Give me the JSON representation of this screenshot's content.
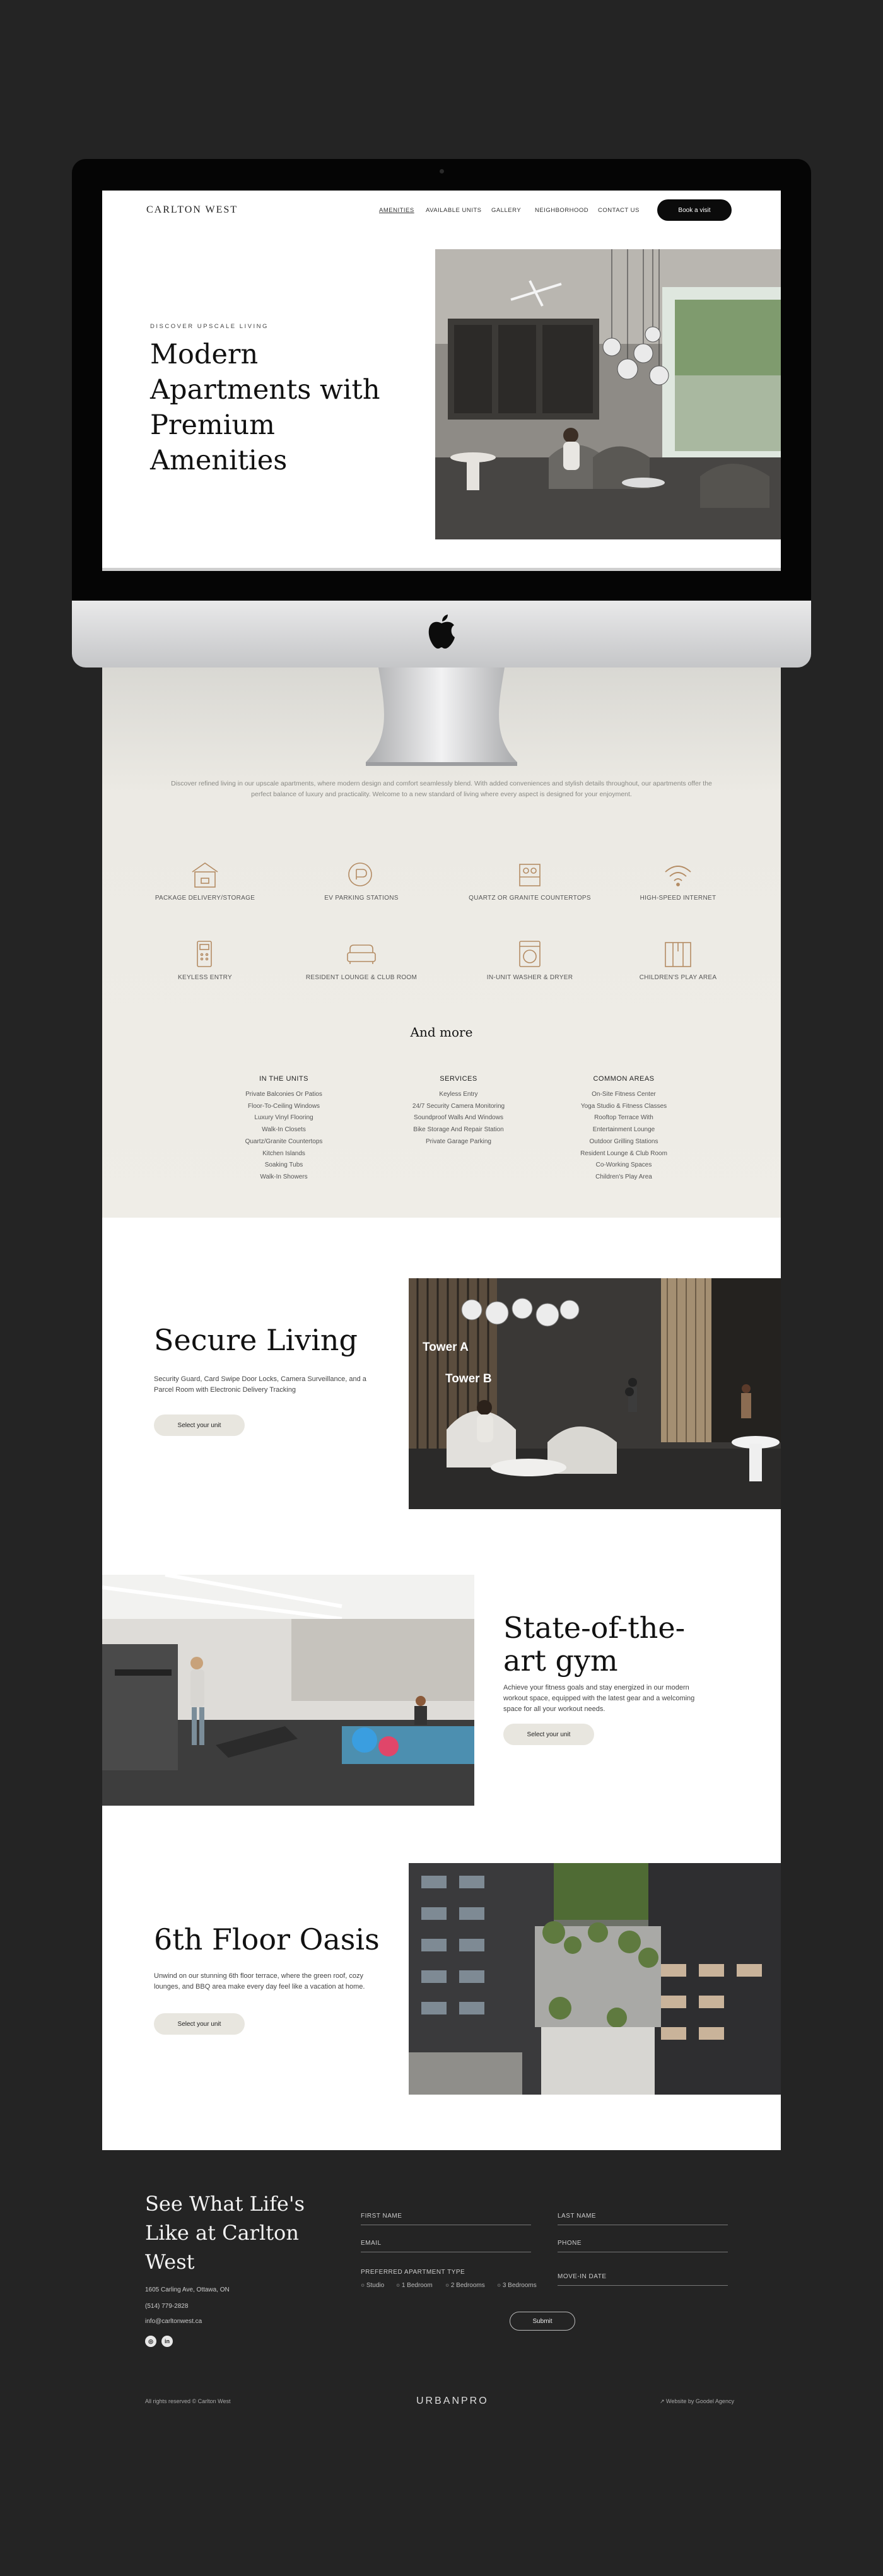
{
  "nav": {
    "logo": "CARLTON WEST",
    "links": [
      "AMENITIES",
      "AVAILABLE UNITS",
      "GALLERY",
      "NEIGHBORHOOD",
      "CONTACT US"
    ],
    "cta": "Book a visit"
  },
  "hero": {
    "eyebrow": "DISCOVER UPSCALE LIVING",
    "title": "Modern Apartments with Premium Amenities"
  },
  "amenities": {
    "intro": "Discover refined living in our upscale apartments, where modern design and comfort seamlessly blend. With added conveniences and stylish details throughout, our apartments offer the perfect balance of luxury and practicality. Welcome to a new standard of living where every aspect is designed for your enjoyment.",
    "items": [
      {
        "label": "PACKAGE DELIVERY/STORAGE",
        "icon": "package-icon"
      },
      {
        "label": "EV PARKING STATIONS",
        "icon": "ev-charging-icon"
      },
      {
        "label": "QUARTZ OR GRANITE COUNTERTOPS",
        "icon": "countertop-icon"
      },
      {
        "label": "HIGH-SPEED INTERNET",
        "icon": "wifi-icon"
      },
      {
        "label": "KEYLESS ENTRY",
        "icon": "keypad-icon"
      },
      {
        "label": "RESIDENT LOUNGE & CLUB ROOM",
        "icon": "sofa-icon"
      },
      {
        "label": "IN-UNIT WASHER & DRYER",
        "icon": "washer-icon"
      },
      {
        "label": "CHILDREN'S PLAY AREA",
        "icon": "play-area-icon"
      }
    ],
    "and_more": "And more",
    "columns": [
      {
        "title": "IN THE UNITS",
        "items": [
          "Private Balconies Or Patios",
          "Floor-To-Ceiling Windows",
          "Luxury Vinyl Flooring",
          "Walk-In Closets",
          "Quartz/Granite Countertops",
          "Kitchen Islands",
          "Soaking Tubs",
          "Walk-In Showers"
        ]
      },
      {
        "title": "SERVICES",
        "items": [
          "Keyless Entry",
          "24/7 Security Camera Monitoring",
          "Soundproof Walls And Windows",
          "Bike Storage And Repair Station",
          "Private Garage Parking"
        ]
      },
      {
        "title": "COMMON AREAS",
        "items": [
          "On-Site Fitness Center",
          "Yoga Studio & Fitness Classes",
          "Rooftop Terrace With",
          "Entertainment Lounge",
          "Outdoor Grilling Stations",
          "Resident Lounge & Club Room",
          "Co-Working Spaces",
          "Children's Play Area"
        ]
      }
    ]
  },
  "features": [
    {
      "title": "Secure Living",
      "text": "Security Guard, Card Swipe Door Locks, Camera Surveillance, and a Parcel Room with Electronic Delivery Tracking",
      "button": "Select your unit",
      "image_labels": [
        "Tower A",
        "Tower B"
      ]
    },
    {
      "title": "State-of-the-art gym",
      "text": "Achieve your fitness goals and stay energized in our modern workout space, equipped with the latest gear and a welcoming space for all your workout needs.",
      "button": "Select your unit"
    },
    {
      "title": "6th Floor Oasis",
      "text": "Unwind on our stunning 6th floor terrace, where the green roof, cozy lounges, and BBQ area make every day feel like a vacation at home.",
      "button": "Select your unit"
    }
  ],
  "footer": {
    "title": "See What Life's Like at Carlton West",
    "address": "1605 Carling Ave, Ottawa, ON",
    "phone": "(514) 779-2828",
    "email": "info@carltonwest.ca",
    "social": [
      "instagram-icon",
      "linkedin-icon"
    ],
    "form": {
      "first_name": "FIRST NAME",
      "last_name": "LAST NAME",
      "email": "EMAIL",
      "phone": "PHONE",
      "apt_type": "PREFERRED APARTMENT TYPE",
      "options": [
        "Studio",
        "1 Bedroom",
        "2 Bedrooms",
        "3 Bedrooms"
      ],
      "move_in": "MOVE-IN DATE",
      "submit": "Submit"
    },
    "rights": "All rights reserved © Carlton West",
    "brand": "URBANPRO",
    "credit": "Website by Goodel Agency"
  },
  "colors": {
    "page_bg": "#242424",
    "accent_beige": "#e8e6df",
    "icon_brown": "#b48c64",
    "nav_button": "#0b0b0b"
  }
}
